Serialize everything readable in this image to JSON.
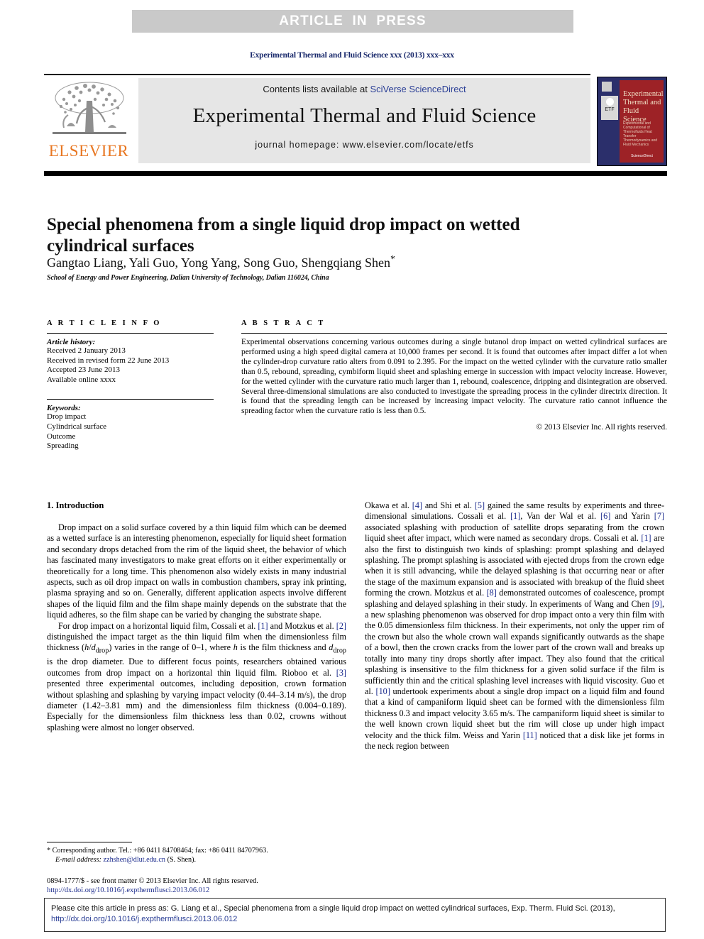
{
  "banner": {
    "text": "ARTICLE  IN  PRESS"
  },
  "running_head": "Experimental Thermal and Fluid Science xxx (2013) xxx–xxx",
  "journal_header": {
    "contents_prefix": "Contents lists available at ",
    "contents_link": "SciVerse ScienceDirect",
    "journal_title": "Experimental Thermal and Fluid Science",
    "homepage": "journal homepage: www.elsevier.com/locate/etfs",
    "publisher_name": "ELSEVIER",
    "cover": {
      "title": "Experimental Thermal and Fluid Science",
      "badge": "ETF",
      "subtitle": "Experimental and Computational of Thermofluids Heat Transfer Thermodynamics and Fluid Mechanics",
      "bottom": "ScienceDirect"
    }
  },
  "article": {
    "title": "Special phenomena from a single liquid drop impact on wetted cylindrical surfaces",
    "authors": "Gangtao Liang, Yali Guo, Yong Yang, Song Guo, Shengqiang Shen",
    "author_star": "*",
    "affiliation": "School of Energy and Power Engineering, Dalian University of Technology, Dalian 116024, China"
  },
  "article_info": {
    "heading": "A R T I C L E   I N F O",
    "history_label": "Article history:",
    "history": [
      "Received 2 January 2013",
      "Received in revised form 22 June 2013",
      "Accepted 23 June 2013",
      "Available online xxxx"
    ],
    "keywords_label": "Keywords:",
    "keywords": [
      "Drop impact",
      "Cylindrical surface",
      "Outcome",
      "Spreading"
    ]
  },
  "abstract": {
    "heading": "A B S T R A C T",
    "text": "Experimental observations concerning various outcomes during a single butanol drop impact on wetted cylindrical surfaces are performed using a high speed digital camera at 10,000 frames per second. It is found that outcomes after impact differ a lot when the cylinder-drop curvature ratio alters from 0.091 to 2.395. For the impact on the wetted cylinder with the curvature ratio smaller than 0.5, rebound, spreading, cymbiform liquid sheet and splashing emerge in succession with impact velocity increase. However, for the wetted cylinder with the curvature ratio much larger than 1, rebound, coalescence, dripping and disintegration are observed. Several three-dimensional simulations are also conducted to investigate the spreading process in the cylinder directrix direction. It is found that the spreading length can be increased by increasing impact velocity. The curvature ratio cannot influence the spreading factor when the curvature ratio is less than 0.5.",
    "copyright": "© 2013 Elsevier Inc. All rights reserved."
  },
  "body": {
    "section_heading": "1. Introduction",
    "left_paragraphs": [
      "Drop impact on a solid surface covered by a thin liquid film which can be deemed as a wetted surface is an interesting phenomenon, especially for liquid sheet formation and secondary drops detached from the rim of the liquid sheet, the behavior of which has fascinated many investigators to make great efforts on it either experimentally or theoretically for a long time. This phenomenon also widely exists in many industrial aspects, such as oil drop impact on walls in combustion chambers, spray ink printing, plasma spraying and so on. Generally, different application aspects involve different shapes of the liquid film and the film shape mainly depends on the substrate that the liquid adheres, so the film shape can be varied by changing the substrate shape.",
      "For drop impact on a horizontal liquid film, Cossali et al. [1] and Motzkus et al. [2] distinguished the impact target as the thin liquid film when the dimensionless film thickness (h/ddrop) varies in the range of 0–1, where h is the film thickness and ddrop is the drop diameter. Due to different focus points, researchers obtained various outcomes from drop impact on a horizontal thin liquid film. Rioboo et al. [3] presented three experimental outcomes, including deposition, crown formation without splashing and splashing by varying impact velocity (0.44–3.14 m/s), the drop diameter (1.42–3.81 mm) and the dimensionless film thickness (0.004–0.189). Especially for the dimensionless film thickness less than 0.02, crowns without splashing were almost no longer observed."
    ],
    "right_paragraph": "Okawa et al. [4] and Shi et al. [5] gained the same results by experiments and three-dimensional simulations. Cossali et al. [1], Van der Wal et al. [6] and Yarin [7] associated splashing with production of satellite drops separating from the crown liquid sheet after impact, which were named as secondary drops. Cossali et al. [1] are also the first to distinguish two kinds of splashing: prompt splashing and delayed splashing. The prompt splashing is associated with ejected drops from the crown edge when it is still advancing, while the delayed splashing is that occurring near or after the stage of the maximum expansion and is associated with breakup of the fluid sheet forming the crown. Motzkus et al. [8] demonstrated outcomes of coalescence, prompt splashing and delayed splashing in their study. In experiments of Wang and Chen [9], a new splashing phenomenon was observed for drop impact onto a very thin film with the 0.05 dimensionless film thickness. In their experiments, not only the upper rim of the crown but also the whole crown wall expands significantly outwards as the shape of a bowl, then the crown cracks from the lower part of the crown wall and breaks up totally into many tiny drops shortly after impact. They also found that the critical splashing is insensitive to the film thickness for a given solid surface if the film is sufficiently thin and the critical splashing level increases with liquid viscosity. Guo et al. [10] undertook experiments about a single drop impact on a liquid film and found that a kind of campaniform liquid sheet can be formed with the dimensionless film thickness 0.3 and impact velocity 3.65 m/s. The campaniform liquid sheet is similar to the well known crown liquid sheet but the rim will close up under high impact velocity and the thick film. Weiss and Yarin [11] noticed that a disk like jet forms in the neck region between"
  },
  "footnote": {
    "star": "*",
    "corresponding": "Corresponding author. Tel.: +86 0411 84708464; fax: +86 0411 84707963.",
    "email_label": "E-mail address:",
    "email": "zzhshen@dlut.edu.cn",
    "email_suffix": "(S. Shen)."
  },
  "issn": {
    "line1": "0894-1777/$ - see front matter © 2013 Elsevier Inc. All rights reserved.",
    "doi": "http://dx.doi.org/10.1016/j.expthermflusci.2013.06.012"
  },
  "cite_box": {
    "text": "Please cite this article in press as: G. Liang et al., Special phenomena from a single liquid drop impact on wetted cylindrical surfaces, Exp. Therm. Fluid Sci. (2013), ",
    "link": "http://dx.doi.org/10.1016/j.expthermflusci.2013.06.012"
  },
  "colors": {
    "banner_bg": "#c9c9c9",
    "header_bg": "#e6e6e6",
    "link": "#2b3f96",
    "ref": "#1a2a8c",
    "elsevier_orange": "#e87722",
    "cover_blue": "#2b2f6b",
    "cover_red": "#9d2226"
  }
}
